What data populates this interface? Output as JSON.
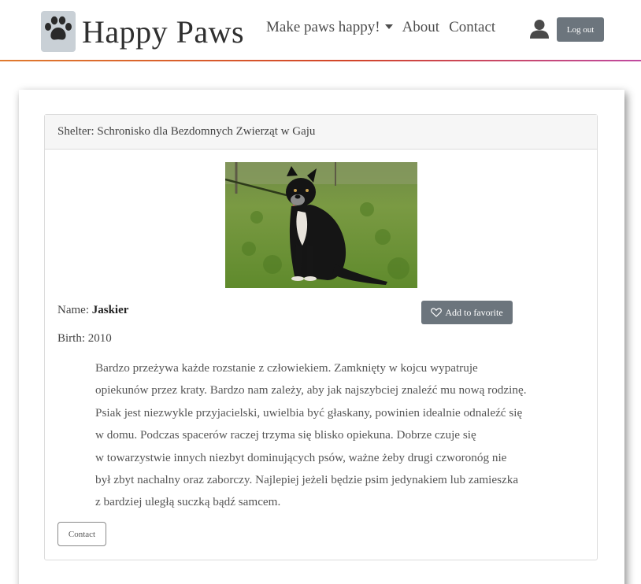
{
  "brand": {
    "name": "Happy Paws",
    "logo_icon": "paw-icon"
  },
  "nav": {
    "links": [
      {
        "label": "Make paws happy!",
        "dropdown": true
      },
      {
        "label": "About"
      },
      {
        "label": "Contact"
      }
    ],
    "user_icon": "user-icon",
    "logout_label": "Log out"
  },
  "colors": {
    "accent_gradient": [
      "#e07a2e",
      "#d2452a",
      "#c04aa0"
    ],
    "button": "#6c757d"
  },
  "card": {
    "header": "Shelter: Schronisko dla Bezdomnych Zwierząt w Gaju",
    "name_label": "Name:",
    "name_value": "Jaskier",
    "birth_label": "Birth:",
    "birth_value": "2010",
    "favorite_label": "Add to favorite",
    "favorite_icon": "heart-icon",
    "description_lines": [
      "Bardzo przeżywa każde rozstanie z człowiekiem.  Zamknięty w kojcu wypatruje",
      "opiekunów przez kraty. Bardzo nam zależy, aby jak najszybciej znaleźć mu nową rodzinę.",
      "Psiak jest niezwykle przyjacielski, uwielbia być głaskany, powinien idealnie odnaleźć się",
      "w domu. Podczas spacerów raczej trzyma się blisko opiekuna. Dobrze czuje się",
      "w towarzystwie innych niezbyt dominujących psów, ważne żeby drugi czworonóg nie",
      "był zbyt nachalny oraz zaborczy. Najlepiej jeżeli będzie psim jedynakiem lub zamieszka",
      "z bardziej uległą suczką bądź samcem."
    ],
    "contact_label": "Contact"
  }
}
